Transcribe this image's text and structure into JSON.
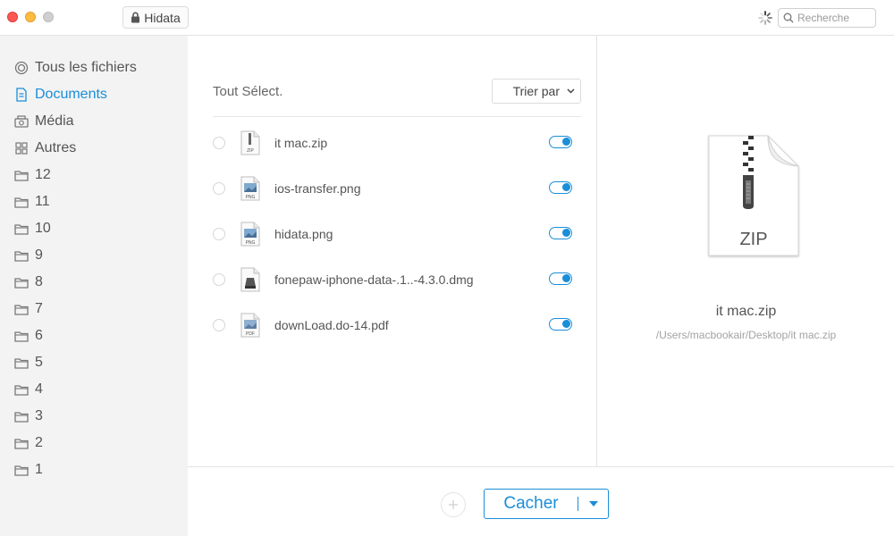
{
  "titlebar": {
    "app_name": "Hidata",
    "search_placeholder": "Recherche"
  },
  "sidebar": {
    "items": [
      {
        "label": "Tous les fichiers",
        "icon": "all-files-icon",
        "active": false
      },
      {
        "label": "Documents",
        "icon": "document-icon",
        "active": true
      },
      {
        "label": "Média",
        "icon": "media-icon",
        "active": false
      },
      {
        "label": "Autres",
        "icon": "grid-icon",
        "active": false
      },
      {
        "label": "12",
        "icon": "folder-icon",
        "active": false
      },
      {
        "label": "11",
        "icon": "folder-icon",
        "active": false
      },
      {
        "label": "10",
        "icon": "folder-icon",
        "active": false
      },
      {
        "label": "9",
        "icon": "folder-icon",
        "active": false
      },
      {
        "label": "8",
        "icon": "folder-icon",
        "active": false
      },
      {
        "label": "7",
        "icon": "folder-icon",
        "active": false
      },
      {
        "label": "6",
        "icon": "folder-icon",
        "active": false
      },
      {
        "label": "5",
        "icon": "folder-icon",
        "active": false
      },
      {
        "label": "4",
        "icon": "folder-icon",
        "active": false
      },
      {
        "label": "3",
        "icon": "folder-icon",
        "active": false
      },
      {
        "label": "2",
        "icon": "folder-icon",
        "active": false
      },
      {
        "label": "1",
        "icon": "folder-icon",
        "active": false
      }
    ]
  },
  "list": {
    "select_all_label": "Tout Sélect.",
    "sort_label": "Trier par",
    "files": [
      {
        "name": "it mac.zip",
        "type": "ZIP",
        "hidden_on": true
      },
      {
        "name": "ios-transfer.png",
        "type": "PNG",
        "hidden_on": true
      },
      {
        "name": "hidata.png",
        "type": "PNG",
        "hidden_on": true
      },
      {
        "name": "fonepaw-iphone-data-.1..-4.3.0.dmg",
        "type": "DMG",
        "hidden_on": true
      },
      {
        "name": "downLoad.do-14.pdf",
        "type": "PDF",
        "hidden_on": true
      }
    ]
  },
  "preview": {
    "type_label": "ZIP",
    "file_name": "it mac.zip",
    "file_path": "/Users/macbookair/Desktop/it mac.zip"
  },
  "bottombar": {
    "hide_label": "Cacher"
  },
  "colors": {
    "accent": "#1a8ed8",
    "sidebar_bg": "#f3f3f3"
  }
}
